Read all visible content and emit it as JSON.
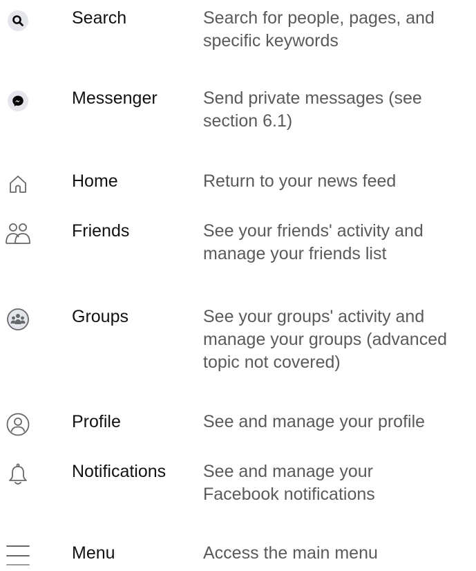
{
  "items": [
    {
      "icon": "search-icon",
      "label": "Search",
      "desc_lines": [
        "Search for people, pages, and",
        "specific keywords"
      ]
    },
    {
      "icon": "messenger-icon",
      "label": "Messenger",
      "desc_lines": [
        "Send private messages (see",
        "section 6.1)"
      ]
    },
    {
      "icon": "home-icon",
      "label": "Home",
      "desc_lines": [
        "Return to your news feed"
      ]
    },
    {
      "icon": "friends-icon",
      "label": "Friends",
      "desc_lines": [
        "See your friends' activity and",
        "manage your friends list"
      ]
    },
    {
      "icon": "groups-icon",
      "label": "Groups",
      "desc_lines": [
        "See your groups' activity and",
        "manage your groups (advanced",
        "topic not covered)"
      ]
    },
    {
      "icon": "profile-icon",
      "label": "Profile",
      "desc_lines": [
        "See and manage your profile"
      ]
    },
    {
      "icon": "bell-icon",
      "label": "Notifications",
      "desc_lines": [
        "See and manage your",
        "Facebook notifications"
      ]
    },
    {
      "icon": "menu-icon",
      "label": "Menu",
      "desc_lines": [
        "Access the main menu"
      ]
    }
  ],
  "colors": {
    "icon_bg": "#e4e6eb",
    "icon_stroke": "#65676b",
    "icon_dark": "#050505",
    "label": "#111111",
    "desc": "#5a5a5a"
  }
}
